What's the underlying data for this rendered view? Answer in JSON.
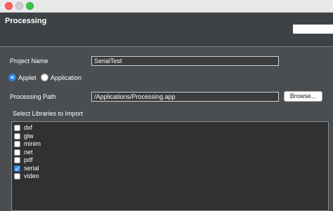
{
  "window": {
    "header_title": "Processing"
  },
  "form": {
    "project_name_label": "Project Name",
    "project_name_value": "SerialTest",
    "applet_label": "Applet",
    "application_label": "Application",
    "selected_type": "Applet",
    "processing_path_label": "Processing Path",
    "processing_path_value": "/Applications/Processing.app",
    "browse_label": "Browse...",
    "libraries_label": "Select Libraries to Import"
  },
  "libraries": [
    {
      "name": "dxf",
      "checked": false
    },
    {
      "name": "glw",
      "checked": false
    },
    {
      "name": "minim",
      "checked": false
    },
    {
      "name": "net",
      "checked": false
    },
    {
      "name": "pdf",
      "checked": false
    },
    {
      "name": "serial",
      "checked": true
    },
    {
      "name": "video",
      "checked": false
    }
  ],
  "colors": {
    "accent": "#3c8cf3",
    "background": "#4b4e51",
    "header": "#3f4244"
  }
}
